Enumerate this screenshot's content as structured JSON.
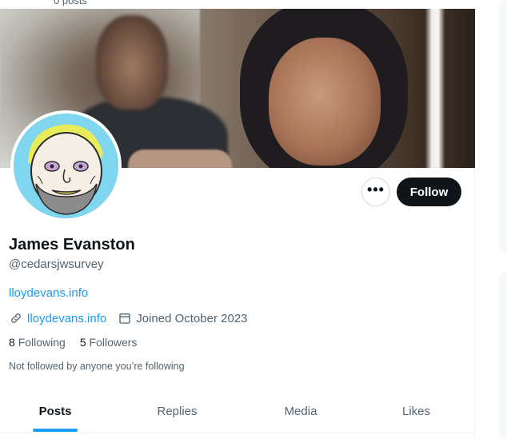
{
  "header": {
    "posts_count": "0 posts"
  },
  "profile": {
    "name": "James Evanston",
    "handle": "@cedarsjwsurvey",
    "bio_link": "lloydevans.info",
    "website": "lloydevans.info",
    "joined": "Joined October 2023",
    "following_count": "8",
    "following_label": "Following",
    "followers_count": "5",
    "followers_label": "Followers",
    "not_followed_text": "Not followed by anyone you’re following"
  },
  "actions": {
    "follow_label": "Follow",
    "more_label": "•••"
  },
  "tabs": [
    {
      "label": "Posts",
      "active": true
    },
    {
      "label": "Replies",
      "active": false
    },
    {
      "label": "Media",
      "active": false
    },
    {
      "label": "Likes",
      "active": false
    }
  ],
  "colors": {
    "accent": "#1d9bf0",
    "text": "#0f1419",
    "muted": "#536471",
    "follow_bg": "#0f1419"
  },
  "icons": {
    "website": "link-icon",
    "joined": "calendar-icon",
    "more": "more-dots-icon"
  }
}
